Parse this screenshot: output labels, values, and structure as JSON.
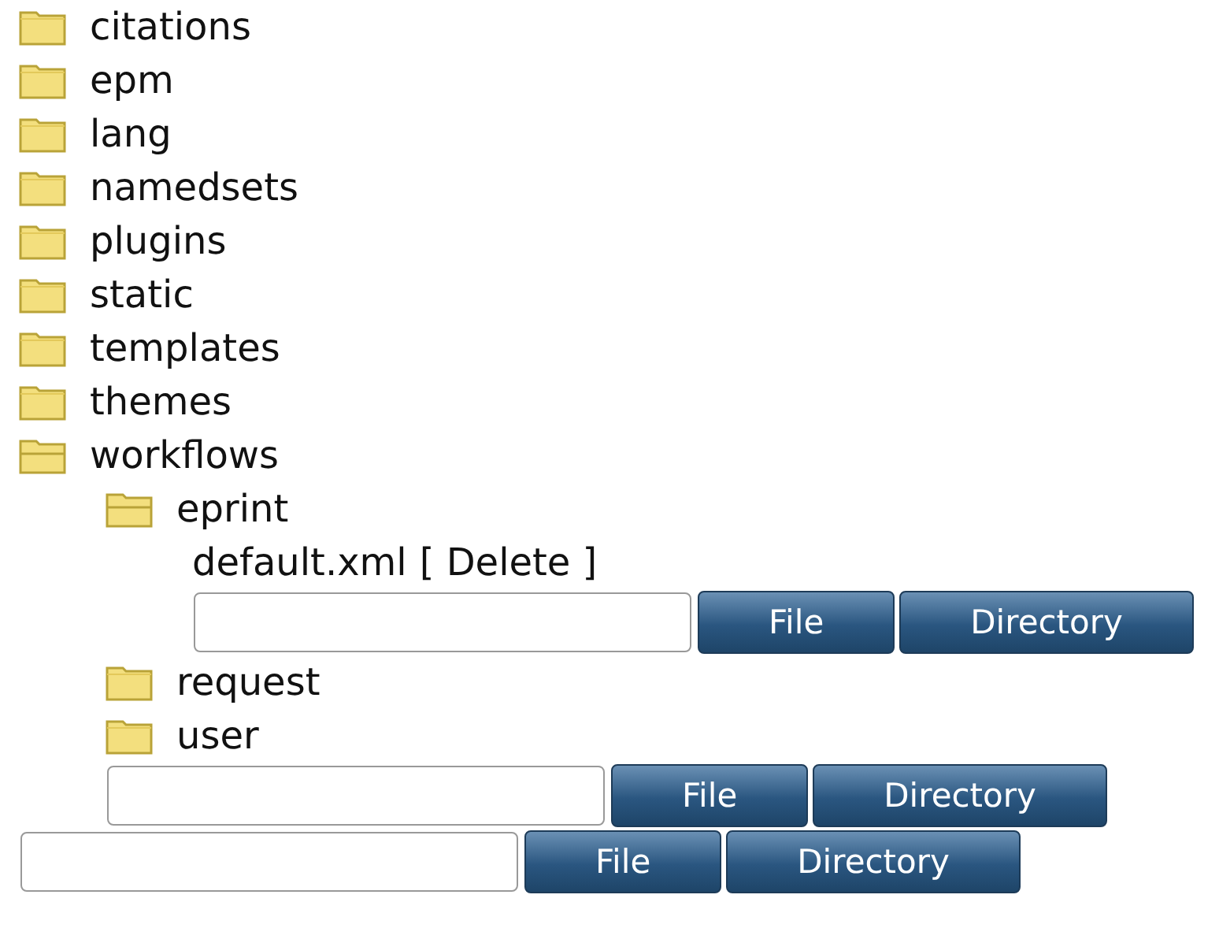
{
  "tree": {
    "folders": [
      {
        "name": "citations",
        "expanded": false
      },
      {
        "name": "epm",
        "expanded": false
      },
      {
        "name": "lang",
        "expanded": false
      },
      {
        "name": "namedsets",
        "expanded": false
      },
      {
        "name": "plugins",
        "expanded": false
      },
      {
        "name": "static",
        "expanded": false
      },
      {
        "name": "templates",
        "expanded": false
      },
      {
        "name": "themes",
        "expanded": false
      },
      {
        "name": "workflows",
        "expanded": true,
        "children": [
          {
            "name": "eprint",
            "expanded": true,
            "files": [
              {
                "name": "default.xml",
                "action": "[ Delete ]"
              }
            ],
            "upload_buttons": [
              "File",
              "Directory"
            ]
          },
          {
            "name": "request",
            "expanded": false
          },
          {
            "name": "user",
            "expanded": false
          }
        ],
        "upload_buttons": [
          "File",
          "Directory"
        ]
      }
    ],
    "upload_buttons": [
      "File",
      "Directory"
    ]
  }
}
